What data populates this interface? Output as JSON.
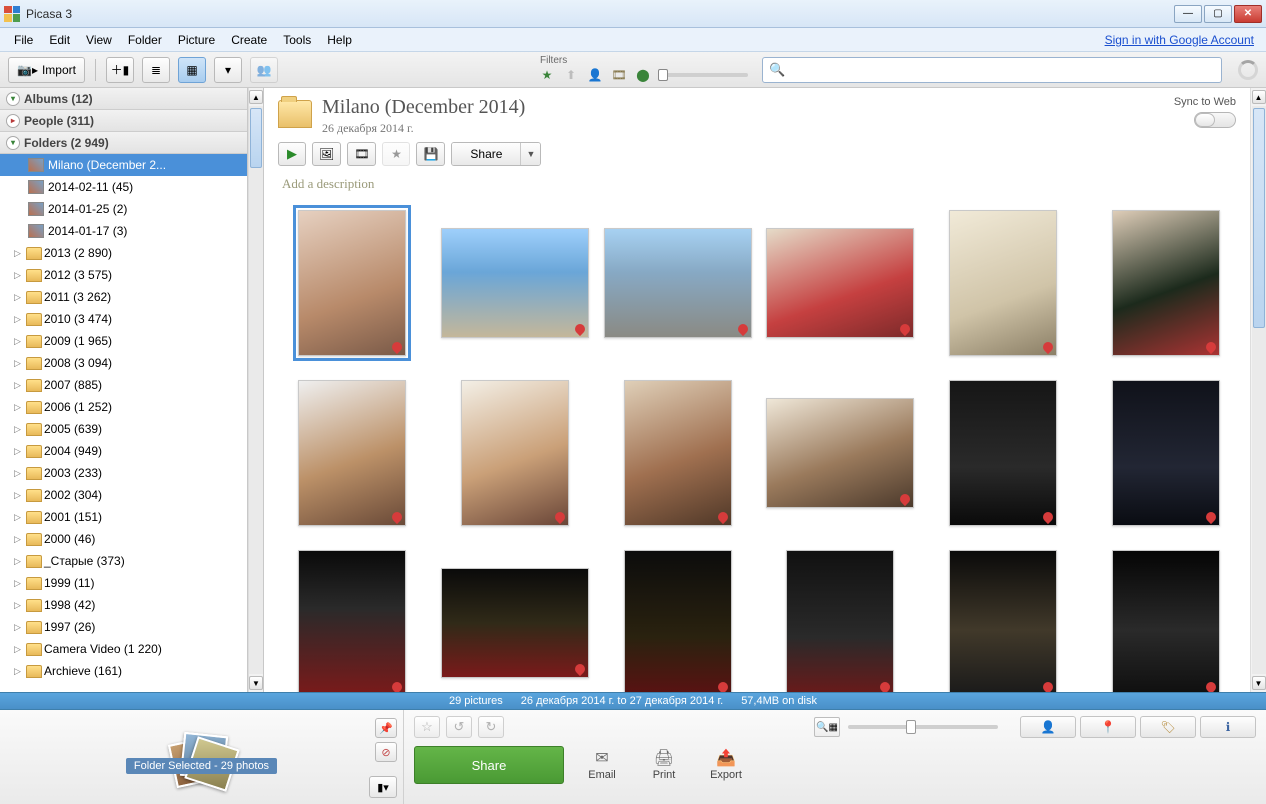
{
  "window": {
    "title": "Picasa 3"
  },
  "menu": {
    "file": "File",
    "edit": "Edit",
    "view": "View",
    "folder": "Folder",
    "picture": "Picture",
    "create": "Create",
    "tools": "Tools",
    "help": "Help",
    "signin": "Sign in with Google Account"
  },
  "toolbar": {
    "import": "Import",
    "filters_label": "Filters"
  },
  "sidebar": {
    "albums": "Albums (12)",
    "people": "People (311)",
    "folders": "Folders (2 949)",
    "recent": [
      {
        "label": "Milano (December 2..."
      },
      {
        "label": "2014-02-11 (45)"
      },
      {
        "label": "2014-01-25 (2)"
      },
      {
        "label": "2014-01-17 (3)"
      }
    ],
    "years": [
      "2013 (2 890)",
      "2012 (3 575)",
      "2011 (3 262)",
      "2010 (3 474)",
      "2009 (1 965)",
      "2008 (3 094)",
      "2007 (885)",
      "2006 (1 252)",
      "2005 (639)",
      "2004 (949)",
      "2003 (233)",
      "2002 (304)",
      "2001 (151)",
      "2000 (46)",
      "_Старые (373)",
      "1999 (11)",
      "1998 (42)",
      "1997 (26)",
      "Camera Video (1 220)",
      "Archieve (161)"
    ]
  },
  "folder": {
    "title": "Milano (December 2014)",
    "date": "26 декабря 2014 г.",
    "sync_label": "Sync to Web",
    "share": "Share",
    "add_desc": "Add a description"
  },
  "grid": {
    "photos": [
      {
        "o": "portrait",
        "g": "g1",
        "geo": true,
        "sel": true
      },
      {
        "o": "landscape",
        "g": "g2",
        "geo": true
      },
      {
        "o": "landscape",
        "g": "g3",
        "geo": true
      },
      {
        "o": "landscape",
        "g": "g4",
        "geo": true
      },
      {
        "o": "portrait",
        "g": "g5",
        "geo": true
      },
      {
        "o": "portrait",
        "g": "g6",
        "geo": true
      },
      {
        "o": "portrait",
        "g": "g7",
        "geo": true
      },
      {
        "o": "portrait",
        "g": "g8",
        "geo": true
      },
      {
        "o": "portrait",
        "g": "g9",
        "geo": true
      },
      {
        "o": "landscape",
        "g": "g10",
        "geo": true
      },
      {
        "o": "portrait",
        "g": "g11",
        "geo": true
      },
      {
        "o": "portrait",
        "g": "g12",
        "geo": true
      },
      {
        "o": "portrait",
        "g": "g13",
        "geo": true
      },
      {
        "o": "landscape",
        "g": "g14",
        "geo": true
      },
      {
        "o": "portrait",
        "g": "g15",
        "geo": true
      },
      {
        "o": "portrait",
        "g": "g16",
        "geo": true
      },
      {
        "o": "portrait",
        "g": "g17",
        "geo": true
      },
      {
        "o": "portrait",
        "g": "g18",
        "geo": true
      }
    ]
  },
  "info": {
    "count": "29 pictures",
    "range": "26 декабря 2014 г. to 27 декабря 2014 г.",
    "size": "57,4MB on disk"
  },
  "tray": {
    "label": "Folder Selected - 29 photos"
  },
  "bottom": {
    "share": "Share",
    "email": "Email",
    "print": "Print",
    "export": "Export"
  }
}
